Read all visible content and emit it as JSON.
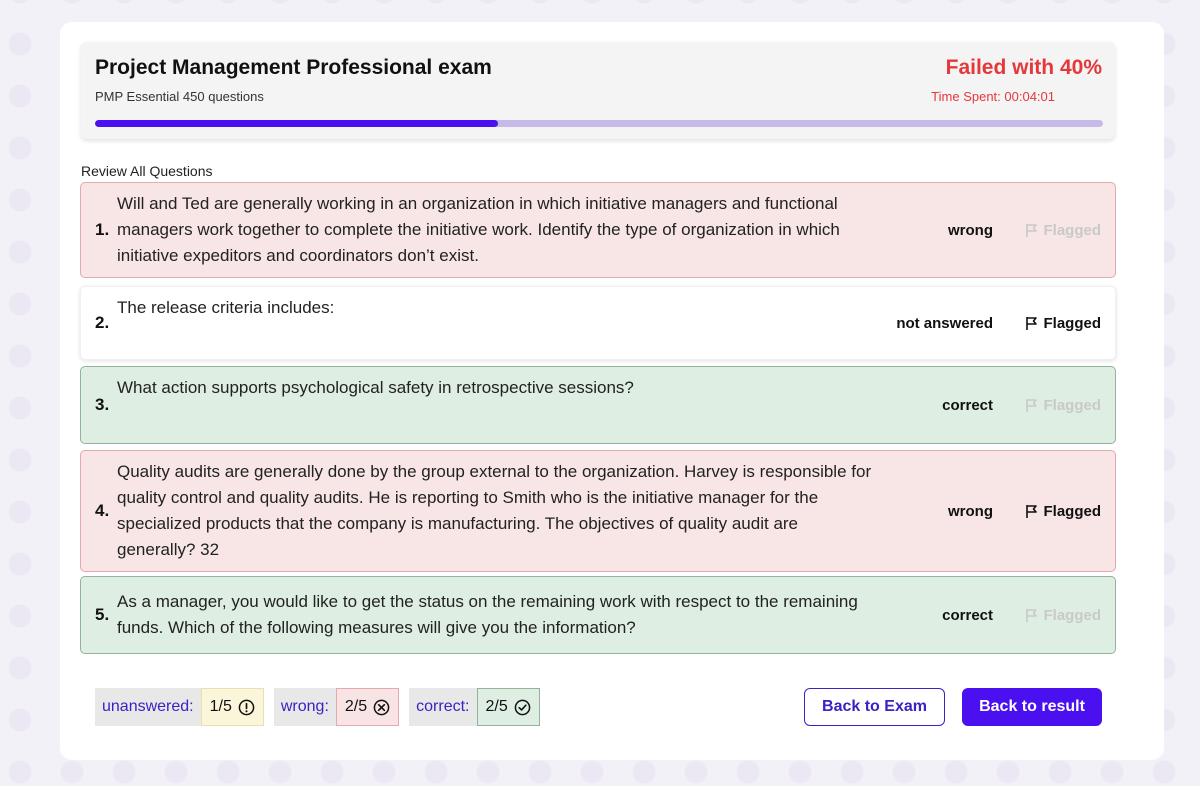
{
  "header": {
    "title": "Project Management Professional exam",
    "subtitle": "PMP Essential 450 questions",
    "result": "Failed with 40%",
    "time_spent": "Time Spent: 00:04:01",
    "progress_fraction": 0.4
  },
  "review_heading": "Review All Questions",
  "questions": [
    {
      "number": "1.",
      "text": "Will and Ted are generally working in an organization in which initiative managers and functional managers work together to complete the initiative work. Identify the type of organization in which initiative expeditors and coordinators don’t exist.",
      "status": "wrong",
      "flag_label": "Flagged",
      "flagged": false
    },
    {
      "number": "2.",
      "text": "The release criteria includes:",
      "status": "not answered",
      "flag_label": "Flagged",
      "flagged": true
    },
    {
      "number": "3.",
      "text": "What action supports psychological safety in retrospective sessions?",
      "status": "correct",
      "flag_label": "Flagged",
      "flagged": false
    },
    {
      "number": "4.",
      "text": "Quality audits are generally done by the group external to the organization. Harvey is responsible for quality control and quality audits. He is reporting to Smith who is the initiative manager for the specialized products that the company is manufacturing. The objectives of quality audit are generally? 32",
      "status": "wrong",
      "flag_label": "Flagged",
      "flagged": true
    },
    {
      "number": "5.",
      "text": "As a manager, you would like to get the status on the remaining work with respect to the remaining funds. Which of the following measures will give you the information?",
      "status": "correct",
      "flag_label": "Flagged",
      "flagged": false
    }
  ],
  "summary": {
    "unanswered_label": "unanswered:",
    "unanswered_count": "1/5",
    "wrong_label": "wrong:",
    "wrong_count": "2/5",
    "correct_label": "correct:",
    "correct_count": "2/5"
  },
  "buttons": {
    "back_to_exam": "Back to Exam",
    "back_to_result": "Back to result"
  },
  "colors": {
    "accent": "#4a10ef",
    "fail": "#e5383b",
    "wrong_bg": "#f8e6e6",
    "correct_bg": "#dfeee2"
  }
}
